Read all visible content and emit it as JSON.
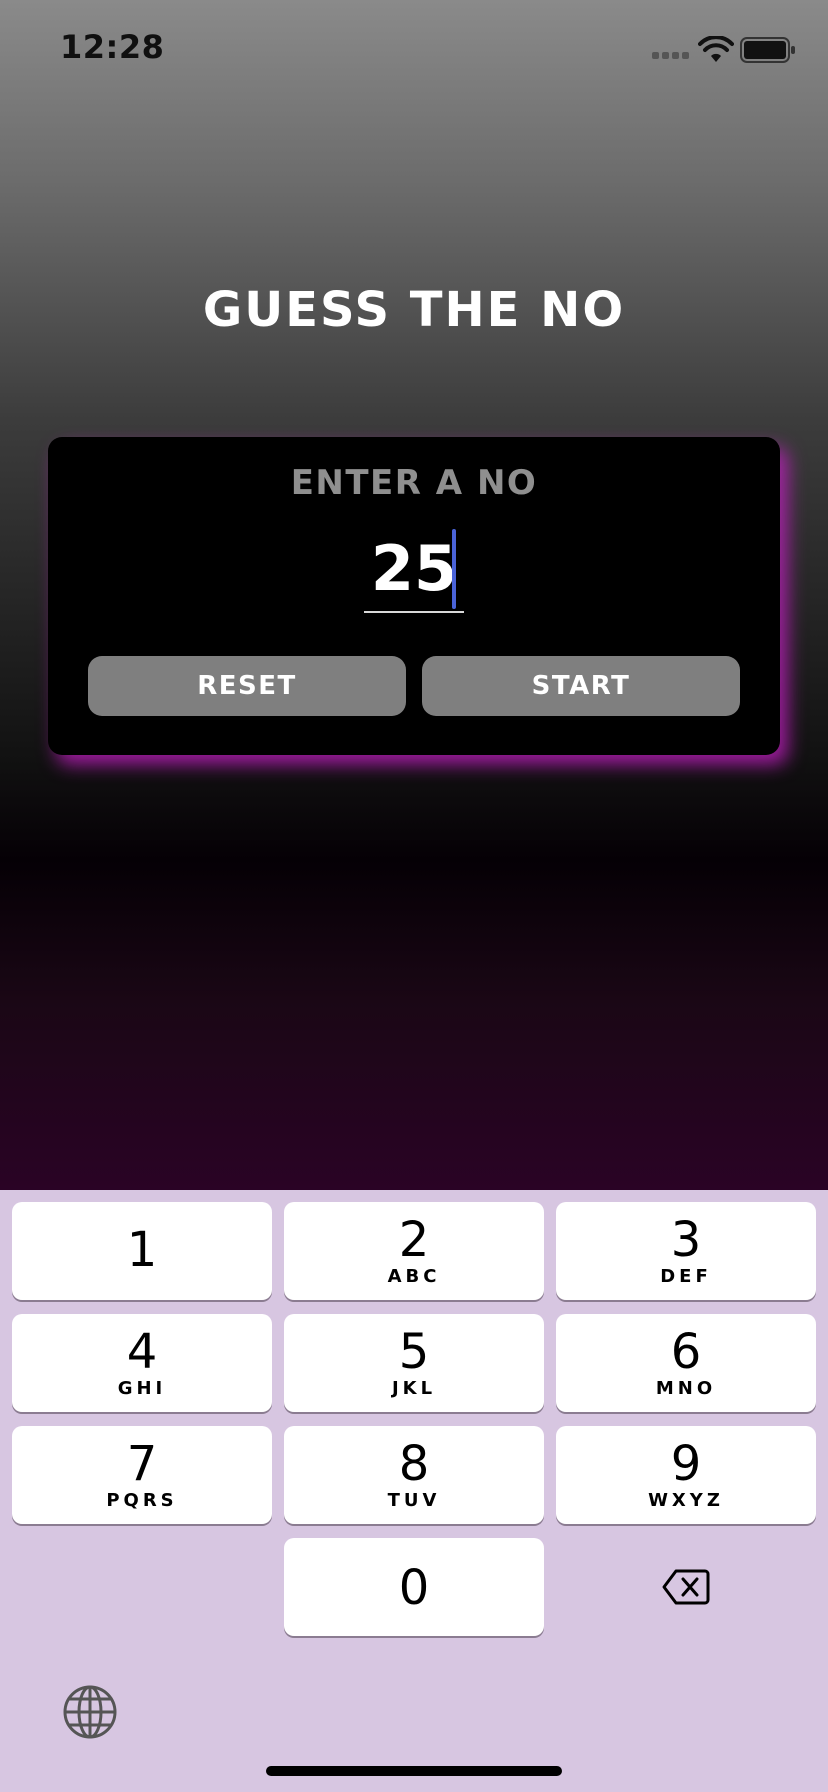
{
  "status_bar": {
    "time": "12:28",
    "icons": [
      "cellular-signal-icon",
      "wifi-icon",
      "battery-icon"
    ]
  },
  "title": "GUESS THE NO",
  "card": {
    "heading": "ENTER A NO",
    "input_value": "25",
    "reset_label": "RESET",
    "start_label": "START"
  },
  "keyboard": {
    "keys": [
      {
        "digit": "1",
        "letters": ""
      },
      {
        "digit": "2",
        "letters": "ABC"
      },
      {
        "digit": "3",
        "letters": "DEF"
      },
      {
        "digit": "4",
        "letters": "GHI"
      },
      {
        "digit": "5",
        "letters": "JKL"
      },
      {
        "digit": "6",
        "letters": "MNO"
      },
      {
        "digit": "7",
        "letters": "PQRS"
      },
      {
        "digit": "8",
        "letters": "TUV"
      },
      {
        "digit": "9",
        "letters": "WXYZ"
      },
      {
        "digit": "0",
        "letters": ""
      }
    ],
    "delete_icon": "delete-backspace-icon",
    "globe_icon": "globe-icon"
  },
  "colors": {
    "accent_glow": "#c81ec8",
    "card_background": "#000000",
    "button_background": "#7f7f7f",
    "cursor": "#4a63d8",
    "keyboard_background": "#d7c6e1"
  }
}
